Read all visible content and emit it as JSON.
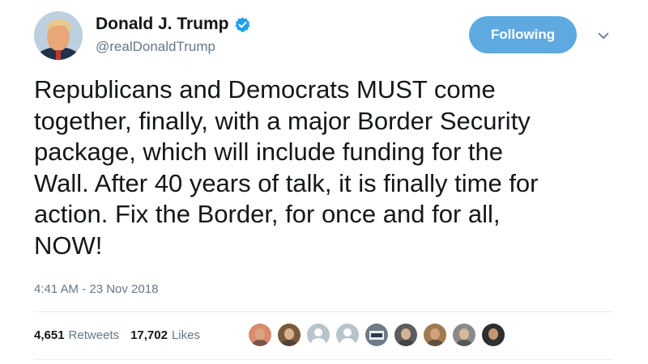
{
  "author": {
    "display_name": "Donald J. Trump",
    "handle": "@realDonaldTrump",
    "verified": true,
    "verified_icon": "verified-badge-icon",
    "verified_color": "#1da1f2"
  },
  "follow_button": {
    "label": "Following",
    "color": "#5ea9e0"
  },
  "menu": {
    "icon": "chevron-down-icon"
  },
  "tweet": {
    "text": "Republicans and Democrats MUST come\ntogether, finally, with a major Border Security\npackage, which will include funding for the\nWall. After 40 years of talk, it is finally time for\naction. Fix the Border, for once and for all,\nNOW!",
    "timestamp": "4:41 AM - 23 Nov 2018"
  },
  "stats": {
    "retweets_count": "4,651",
    "retweets_label": "Retweets",
    "likes_count": "17,702",
    "likes_label": "Likes"
  },
  "likers": [
    {
      "kind": "photo",
      "bg": "#d98b6f"
    },
    {
      "kind": "photo",
      "bg": "#7a5a3a"
    },
    {
      "kind": "default",
      "bg": "#b8c4cc"
    },
    {
      "kind": "default",
      "bg": "#b8c4cc"
    },
    {
      "kind": "badge",
      "bg": "#6f7b87"
    },
    {
      "kind": "photo",
      "bg": "#5c5c5c"
    },
    {
      "kind": "photo",
      "bg": "#a07a50"
    },
    {
      "kind": "photo",
      "bg": "#8a8a8a"
    },
    {
      "kind": "photo",
      "bg": "#2e2e2e"
    }
  ]
}
